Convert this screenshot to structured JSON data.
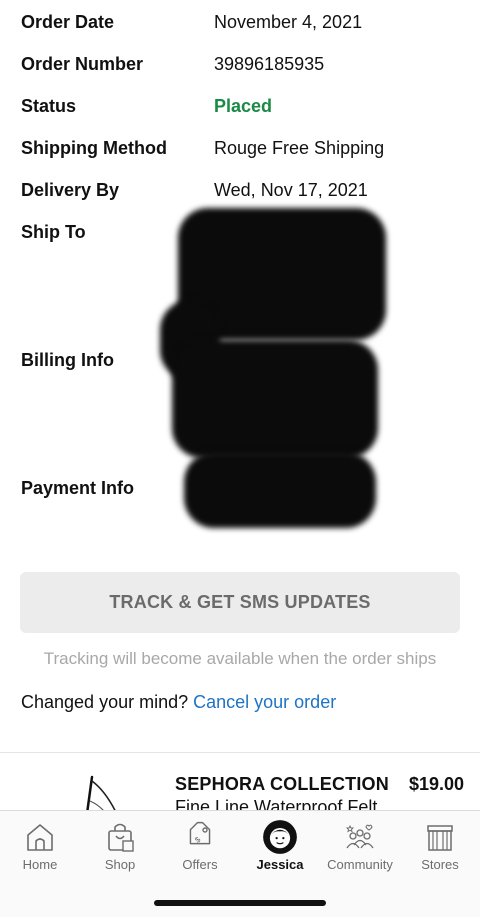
{
  "order": {
    "rows": [
      {
        "label": "Order Date",
        "value": "November 4, 2021"
      },
      {
        "label": "Order Number",
        "value": "39896185935"
      },
      {
        "label": "Status",
        "value": "Placed"
      },
      {
        "label": "Shipping Method",
        "value": "Rouge Free Shipping"
      },
      {
        "label": "Delivery By",
        "value": "Wed, Nov 17, 2021"
      }
    ],
    "ship_to_label": "Ship To",
    "billing_label": "Billing Info",
    "payment_label": "Payment Info",
    "status_color": "#1a8a45"
  },
  "actions": {
    "track_button": "TRACK & GET SMS UPDATES",
    "track_note": "Tracking will become available when the order ships",
    "changed_mind": "Changed your mind?",
    "cancel_link": "Cancel your order",
    "link_color": "#1f73c6"
  },
  "product": {
    "brand": "SEPHORA COLLECTION",
    "price": "$19.00",
    "name": "Fine Line Waterproof Felt"
  },
  "tabbar": {
    "tabs": [
      {
        "label": "Home",
        "icon": "home-icon"
      },
      {
        "label": "Shop",
        "icon": "shopping-bag-icon"
      },
      {
        "label": "Offers",
        "icon": "offer-tag-icon"
      },
      {
        "label": "Jessica",
        "icon": "profile-avatar-icon",
        "active": true
      },
      {
        "label": "Community",
        "icon": "community-icon"
      },
      {
        "label": "Stores",
        "icon": "store-icon"
      }
    ]
  }
}
